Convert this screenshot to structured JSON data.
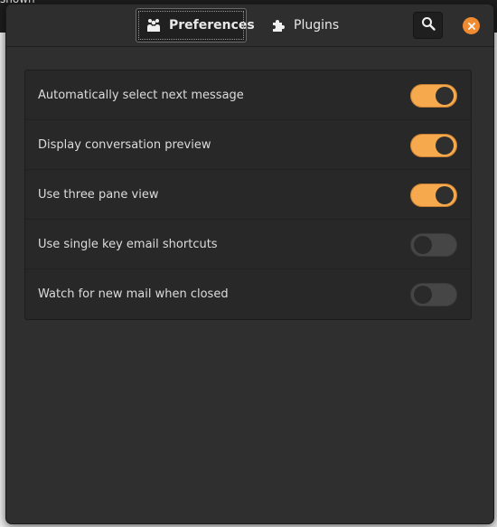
{
  "background_window": {
    "partial_text": "shown"
  },
  "header": {
    "tabs": [
      {
        "label": "Preferences",
        "icon": "people-icon",
        "active": true
      },
      {
        "label": "Plugins",
        "icon": "puzzle-icon",
        "active": false
      }
    ],
    "search_icon": "search-icon",
    "close_icon": "close-icon"
  },
  "settings": {
    "items": [
      {
        "label": "Automatically select next message",
        "enabled": true
      },
      {
        "label": "Display conversation preview",
        "enabled": true
      },
      {
        "label": "Use three pane view",
        "enabled": true
      },
      {
        "label": "Use single key email shortcuts",
        "enabled": false
      },
      {
        "label": "Watch for new mail when closed",
        "enabled": false
      }
    ]
  },
  "colors": {
    "accent": "#f6a94d",
    "close_button": "#ef8b31",
    "dialog_bg": "#2f2f2f",
    "switch_off": "#464646"
  }
}
